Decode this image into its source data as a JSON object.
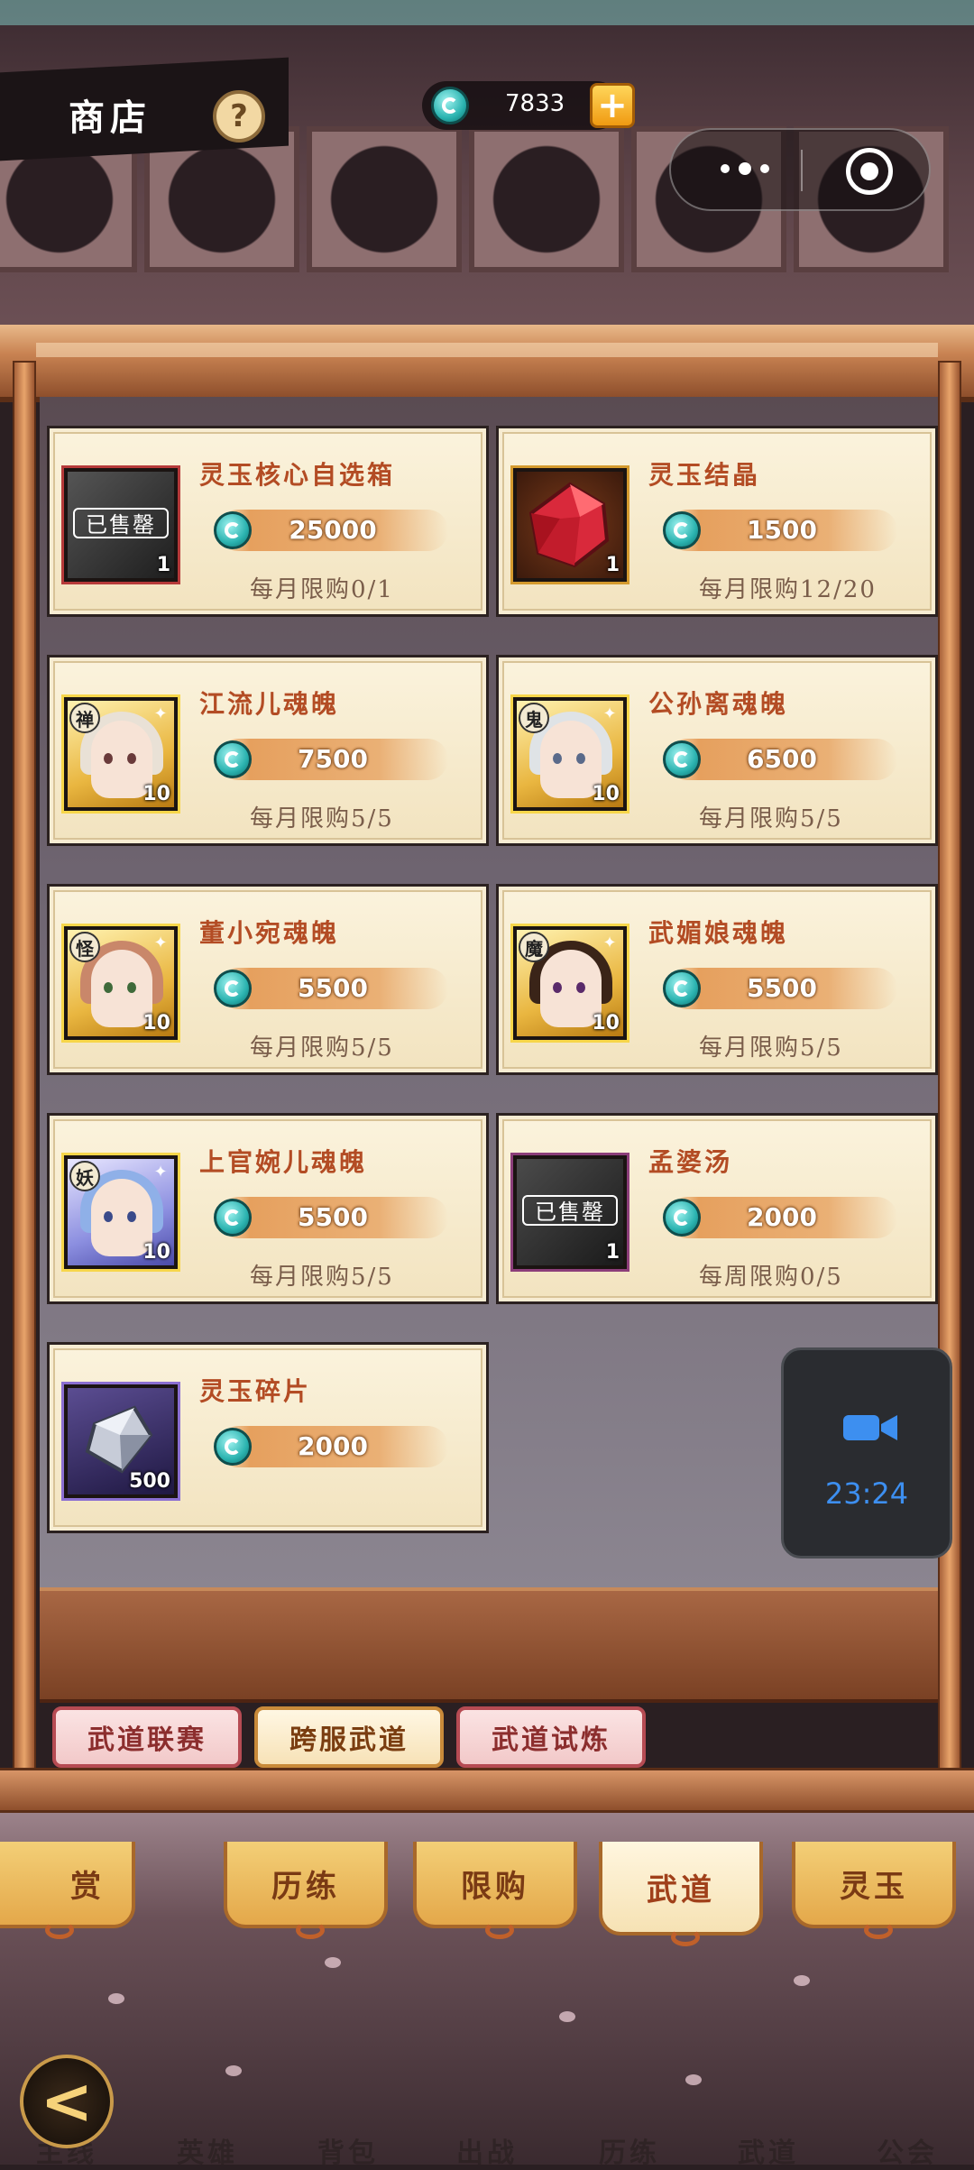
{
  "header": {
    "title": "商店",
    "help_symbol": "?",
    "currency_amount": "7833",
    "plus_symbol": "+"
  },
  "sold_out_label": "已售罄",
  "items": [
    {
      "name": "灵玉核心自选箱",
      "price": "25000",
      "limit": "每月限购0/1",
      "qty": "1",
      "icon": "chest-icon",
      "sold_out": true
    },
    {
      "name": "灵玉结晶",
      "price": "1500",
      "limit": "每月限购12/20",
      "qty": "1",
      "icon": "red-gem-icon",
      "sold_out": false
    },
    {
      "name": "江流儿魂魄",
      "price": "7500",
      "limit": "每月限购5/5",
      "qty": "10",
      "icon": "hero-portrait-icon",
      "faction": "禅"
    },
    {
      "name": "公孙离魂魄",
      "price": "6500",
      "limit": "每月限购5/5",
      "qty": "10",
      "icon": "hero-portrait-icon",
      "faction": "鬼"
    },
    {
      "name": "董小宛魂魄",
      "price": "5500",
      "limit": "每月限购5/5",
      "qty": "10",
      "icon": "hero-portrait-icon",
      "faction": "怪"
    },
    {
      "name": "武媚娘魂魄",
      "price": "5500",
      "limit": "每月限购5/5",
      "qty": "10",
      "icon": "hero-portrait-icon",
      "faction": "魔"
    },
    {
      "name": "上官婉儿魂魄",
      "price": "5500",
      "limit": "每月限购5/5",
      "qty": "10",
      "icon": "hero-portrait-icon",
      "faction": "妖"
    },
    {
      "name": "孟婆汤",
      "price": "2000",
      "limit": "每周限购0/5",
      "qty": "1",
      "icon": "soup-bowl-icon",
      "sold_out": true
    },
    {
      "name": "灵玉碎片",
      "price": "2000",
      "limit": "",
      "qty": "500",
      "icon": "crystal-shard-icon",
      "sold_out": false
    }
  ],
  "sub_tabs": [
    "武道联赛",
    "跨服武道",
    "武道试炼"
  ],
  "sub_tab_active": "跨服武道",
  "bottom_tabs": [
    "赏",
    "历练",
    "限购",
    "武道",
    "灵玉"
  ],
  "bottom_tab_active": "武道",
  "bottom_nav_faint": [
    "主线",
    "英雄",
    "背包",
    "出战",
    "历练",
    "武道",
    "公会"
  ],
  "recording": {
    "time": "23:24"
  },
  "back_symbol": "<",
  "colors": {
    "item_name": "#b34c24",
    "price_bar": "#e6a05e",
    "coin": "#2bb3b0",
    "tab_active": "#f6e2b4",
    "recording_time": "#3d8ff0"
  }
}
